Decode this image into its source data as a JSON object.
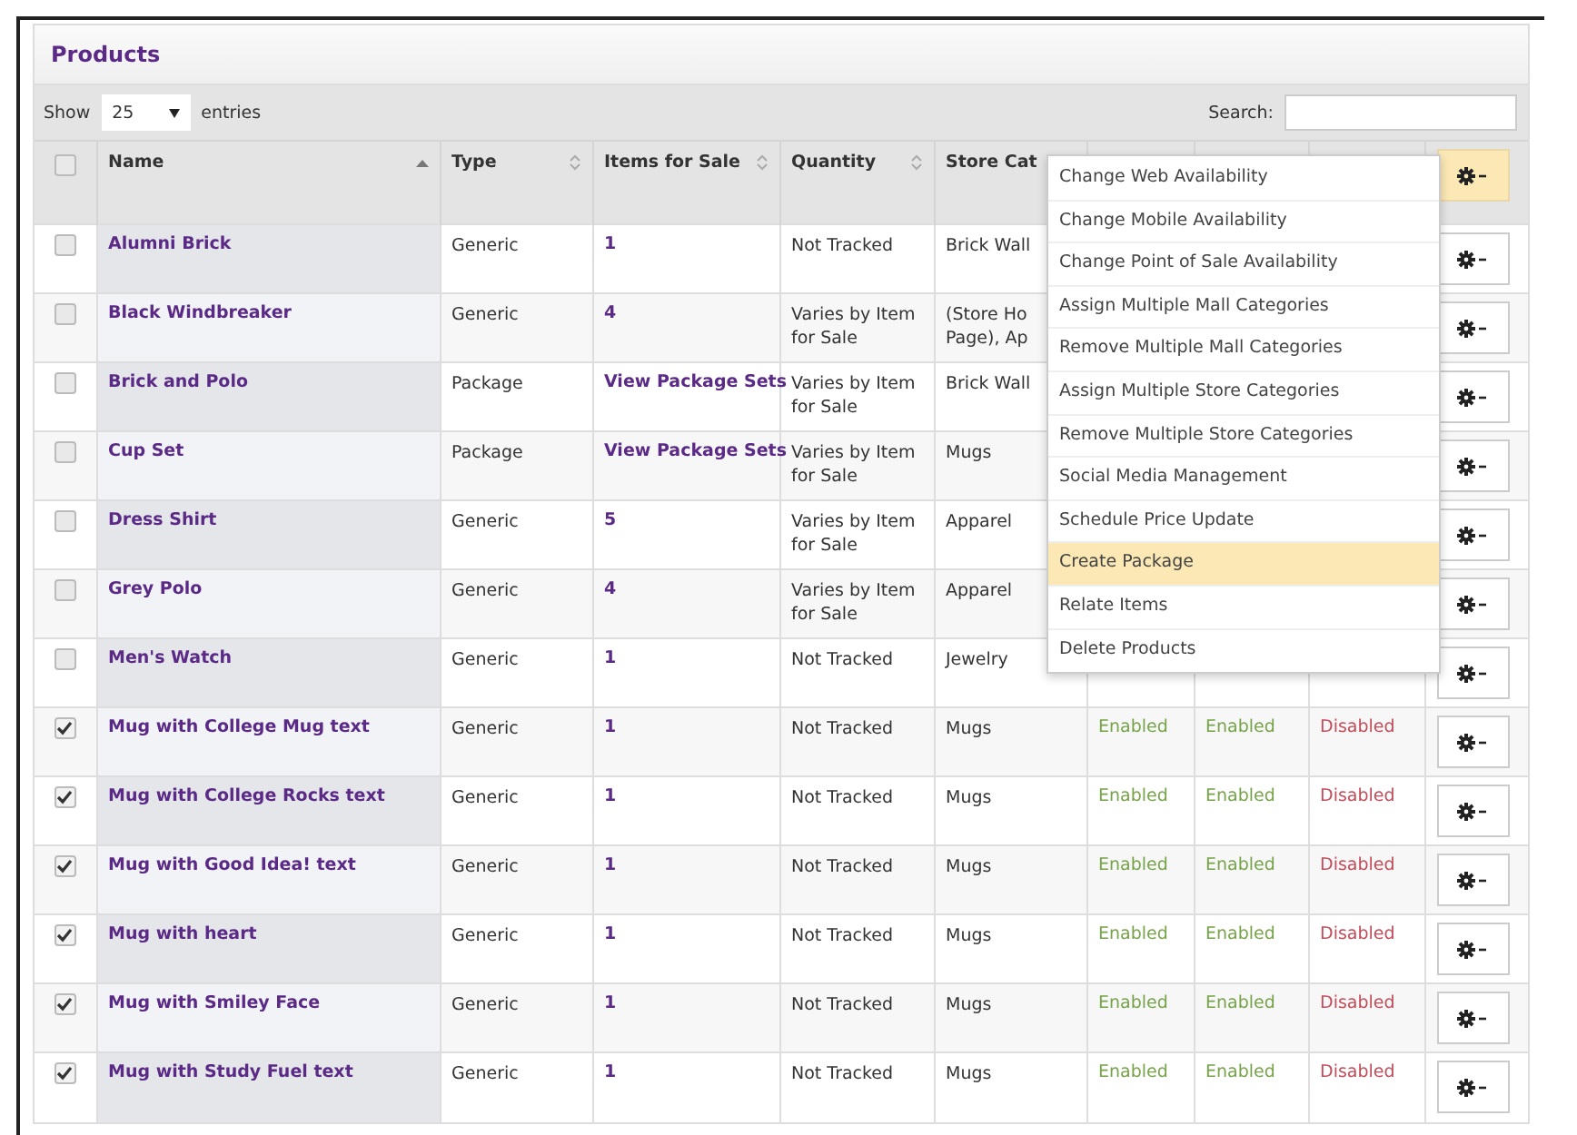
{
  "panel": {
    "title": "Products"
  },
  "length": {
    "label_before": "Show",
    "value": "25",
    "label_after": "entries"
  },
  "search": {
    "label": "Search:"
  },
  "select_all": {
    "checked": false
  },
  "columns": [
    {
      "label": "Name",
      "sorted": true
    },
    {
      "label": "Type",
      "sorted": false
    },
    {
      "label": "Items for Sale",
      "sorted": false
    },
    {
      "label": "Quantity",
      "sorted": false
    },
    {
      "label": "Store Cat"
    }
  ],
  "actions_open": true,
  "rows": [
    {
      "checked": false,
      "name": "Alumni Brick",
      "type": "Generic",
      "items": "1",
      "quantity": "Not Tracked",
      "store_category": "Brick Wall"
    },
    {
      "checked": false,
      "name": "Black Windbreaker",
      "type": "Generic",
      "items": "4",
      "quantity": "Varies by Item for Sale",
      "store_category": "(Store Ho\nPage), Ap"
    },
    {
      "checked": false,
      "name": "Brick and Polo",
      "type": "Package",
      "items": "View Package Sets",
      "quantity": "Varies by Item for Sale",
      "store_category": "Brick Wall"
    },
    {
      "checked": false,
      "name": "Cup Set",
      "type": "Package",
      "items": "View Package Sets",
      "quantity": "Varies by Item for Sale",
      "store_category": "Mugs"
    },
    {
      "checked": false,
      "name": "Dress Shirt",
      "type": "Generic",
      "items": "5",
      "quantity": "Varies by Item for Sale",
      "store_category": "Apparel"
    },
    {
      "checked": false,
      "name": "Grey Polo",
      "type": "Generic",
      "items": "4",
      "quantity": "Varies by Item for Sale",
      "store_category": "Apparel"
    },
    {
      "checked": false,
      "name": "Men's Watch",
      "type": "Generic",
      "items": "1",
      "quantity": "Not Tracked",
      "store_category": "Jewelry"
    },
    {
      "checked": true,
      "name": "Mug with College Mug text",
      "type": "Generic",
      "items": "1",
      "quantity": "Not Tracked",
      "store_category": "Mugs",
      "availability": [
        {
          "label": "Enabled",
          "on": true
        },
        {
          "label": "Enabled",
          "on": true
        },
        {
          "label": "Disabled",
          "on": false
        }
      ]
    },
    {
      "checked": true,
      "name": "Mug with College Rocks text",
      "type": "Generic",
      "items": "1",
      "quantity": "Not Tracked",
      "store_category": "Mugs",
      "availability": [
        {
          "label": "Enabled",
          "on": true
        },
        {
          "label": "Enabled",
          "on": true
        },
        {
          "label": "Disabled",
          "on": false
        }
      ]
    },
    {
      "checked": true,
      "name": "Mug with Good Idea! text",
      "type": "Generic",
      "items": "1",
      "quantity": "Not Tracked",
      "store_category": "Mugs",
      "availability": [
        {
          "label": "Enabled",
          "on": true
        },
        {
          "label": "Enabled",
          "on": true
        },
        {
          "label": "Disabled",
          "on": false
        }
      ]
    },
    {
      "checked": true,
      "name": "Mug with heart",
      "type": "Generic",
      "items": "1",
      "quantity": "Not Tracked",
      "store_category": "Mugs",
      "availability": [
        {
          "label": "Enabled",
          "on": true
        },
        {
          "label": "Enabled",
          "on": true
        },
        {
          "label": "Disabled",
          "on": false
        }
      ]
    },
    {
      "checked": true,
      "name": "Mug with Smiley Face",
      "type": "Generic",
      "items": "1",
      "quantity": "Not Tracked",
      "store_category": "Mugs",
      "availability": [
        {
          "label": "Enabled",
          "on": true
        },
        {
          "label": "Enabled",
          "on": true
        },
        {
          "label": "Disabled",
          "on": false
        }
      ]
    },
    {
      "checked": true,
      "name": "Mug with Study Fuel text",
      "type": "Generic",
      "items": "1",
      "quantity": "Not Tracked",
      "store_category": "Mugs",
      "availability": [
        {
          "label": "Enabled",
          "on": true
        },
        {
          "label": "Enabled",
          "on": true
        },
        {
          "label": "Disabled",
          "on": false
        }
      ]
    }
  ],
  "menu": [
    {
      "label": "Change Web Availability",
      "selected": false
    },
    {
      "label": "Change Mobile Availability",
      "selected": false
    },
    {
      "label": "Change Point of Sale Availability",
      "selected": false
    },
    {
      "label": "Assign Multiple Mall Categories",
      "selected": false
    },
    {
      "label": "Remove Multiple Mall Categories",
      "selected": false
    },
    {
      "label": "Assign Multiple Store Categories",
      "selected": false
    },
    {
      "label": "Remove Multiple Store Categories",
      "selected": false
    },
    {
      "label": "Social Media Management",
      "selected": false
    },
    {
      "label": "Schedule Price Update",
      "selected": false
    },
    {
      "label": "Create Package",
      "selected": true
    },
    {
      "label": "Relate Items",
      "selected": false
    },
    {
      "label": "Delete Products",
      "selected": false
    }
  ]
}
